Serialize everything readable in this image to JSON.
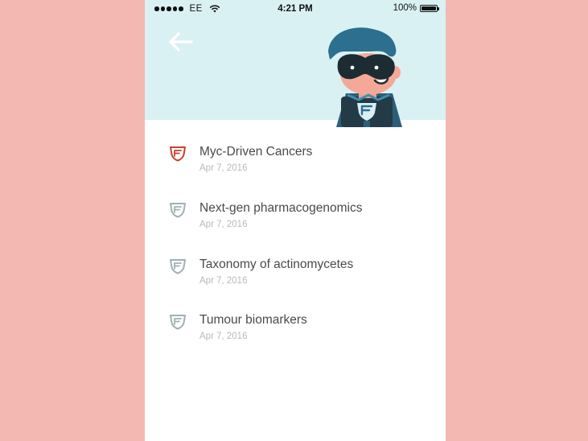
{
  "status_bar": {
    "carrier": "EE",
    "time": "4:21 PM",
    "battery": "100%"
  },
  "header": {
    "back_icon": "arrow-left-icon",
    "illustration": "superhero-mascot",
    "background_color": "#daf1f4"
  },
  "items": [
    {
      "title": "Myc-Driven Cancers",
      "date": "Apr 7, 2016",
      "active": true
    },
    {
      "title": "Next-gen pharmacogenomics",
      "date": "Apr 7, 2016",
      "active": false
    },
    {
      "title": "Taxonomy of actinomycetes",
      "date": "Apr 7, 2016",
      "active": false
    },
    {
      "title": "Tumour biomarkers",
      "date": "Apr 7, 2016",
      "active": false
    }
  ],
  "colors": {
    "page_background": "#f3b8b2",
    "active_icon": "#c9412d",
    "inactive_icon": "#9fb0b3",
    "hero_blue": "#2d6f8f"
  }
}
